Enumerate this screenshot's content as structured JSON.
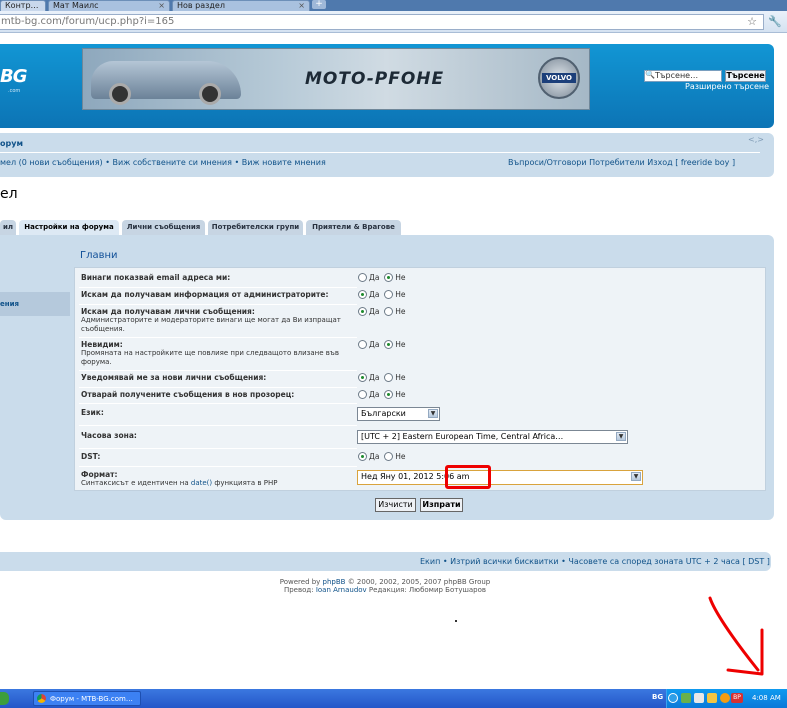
{
  "browser": {
    "tabs": [
      {
        "label": "Контр…"
      },
      {
        "label": "Мат Маилс"
      },
      {
        "label": "Нов раздел"
      }
    ],
    "new_tab_label": "+",
    "url_dim": "mtb-bg.com",
    "url_path": "/forum/ucp.php?i=165"
  },
  "header": {
    "logo": "BG",
    "logo_sub": ".com",
    "banner_text": "MOTO-PFOHE",
    "banner_badge": "VOLVO",
    "search_placeholder": "Търсене…",
    "search_button": "Търсене",
    "advanced_search": "Разширено търсене"
  },
  "navbar": {
    "forum_link": "орум",
    "left_links": "мел (0 нови съобщения) • Виж собствените си мнения • Виж новите мнения",
    "right_links": "Въпроси/Отговори  Потребители  Изход [ freeride boy ]"
  },
  "page_title": "ел",
  "tabs": [
    {
      "label": "ил"
    },
    {
      "label": "Настройки на форума"
    },
    {
      "label": "Лични съобщения"
    },
    {
      "label": "Потребителски групи"
    },
    {
      "label": "Приятели & Врагове"
    }
  ],
  "sidebar": {
    "active_item": "ения"
  },
  "main": {
    "heading": "Главни",
    "options": [
      {
        "label": "Винаги показвай email адреса ми:",
        "explain": "",
        "yes": "Да",
        "no": "Не",
        "selected": "no"
      },
      {
        "label": "Искам да получавам информация от администраторите:",
        "explain": "",
        "yes": "Да",
        "no": "Не",
        "selected": "yes"
      },
      {
        "label": "Искам да получавам лични съобщения:",
        "explain": "Администраторите и модераторите винаги ще могат да Ви изпращат съобщения.",
        "yes": "Да",
        "no": "Не",
        "selected": "yes"
      },
      {
        "label": "Невидим:",
        "explain": "Промяната на настройките ще повлияе при следващото влизане във форума.",
        "yes": "Да",
        "no": "Не",
        "selected": "no"
      },
      {
        "label": "Уведомявай ме за нови лични съобщения:",
        "explain": "",
        "yes": "Да",
        "no": "Не",
        "selected": "yes"
      },
      {
        "label": "Отварай получените съобщения в нов прозорец:",
        "explain": "",
        "yes": "Да",
        "no": "Не",
        "selected": "no"
      }
    ],
    "language_label": "Език:",
    "language_value": "Български",
    "timezone_label": "Часова зона:",
    "timezone_value": "[UTC + 2] Eastern European Time, Central Africa…",
    "dst_label": "DST:",
    "dst_yes": "Да",
    "dst_no": "Не",
    "dst_selected": "yes",
    "format_label": "Формат:",
    "format_explain_pre": "Синтаксисът е идентичен на ",
    "format_explain_link": "date()",
    "format_explain_post": " функцията в PHP",
    "format_value": "Нед Яну 01, 2012 5:06 am",
    "reset_button": "Изчисти",
    "submit_button": "Изпрати"
  },
  "footer": {
    "links": "Екип • Изтрий всички бисквитки • Часовете са според зоната UTC + 2 часа [ DST ]",
    "powered_pre": "Powered by ",
    "powered_link": "phpBB",
    "powered_post": " © 2000, 2002, 2005, 2007 phpBB Group",
    "translation_pre": "Превод: ",
    "translation_link": "Ioan Arnaudov",
    "translation_post": " Редакция: Любомир Ботушаров"
  },
  "taskbar": {
    "window_label": "Форум - MTB-BG.com…",
    "lang": "BG",
    "clock": "4:08 AM"
  },
  "colors": {
    "annotation": "#e00000",
    "header_blue": "#0c74b5",
    "panel": "#cadceb"
  }
}
